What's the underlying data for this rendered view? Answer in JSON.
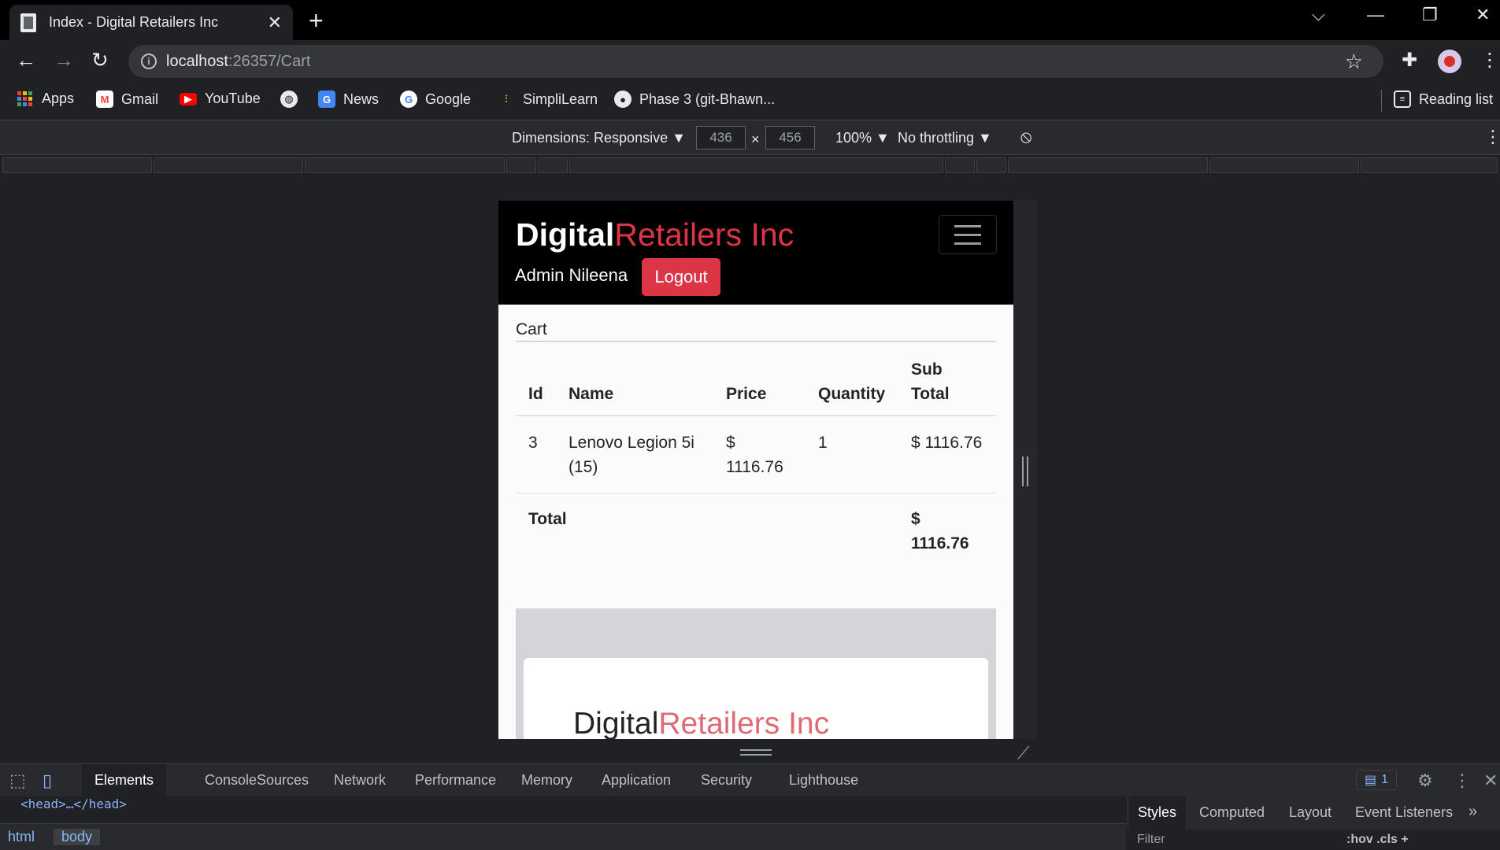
{
  "browser": {
    "tab_title": "Index - Digital Retailers Inc",
    "url_host": "localhost",
    "url_path": ":26357/Cart",
    "bookmarks": [
      "Apps",
      "Gmail",
      "YouTube",
      "News",
      "Google",
      "SimpliLearn",
      "Phase 3 (git-Bhawn..."
    ],
    "reading_list": "Reading list"
  },
  "device_toolbar": {
    "dimensions": "Dimensions: Responsive ▼",
    "width": "436",
    "x": "×",
    "height": "456",
    "zoom": "100% ▼",
    "throttling": "No throttling ▼"
  },
  "site": {
    "brand_a": "Digital",
    "brand_b": "Retailers Inc",
    "admin_name": "Admin Nileena",
    "logout_label": "Logout",
    "cart_heading": "Cart",
    "columns": [
      "Id",
      "Name",
      "Price",
      "Quantity",
      "Sub",
      "Total"
    ],
    "rows": [
      {
        "id": "3",
        "name": "Lenovo Legion 5i (15)",
        "price": "$ 1116.76",
        "quantity": "1",
        "subtotal": "$ 1116.76"
      }
    ],
    "total_label": "Total",
    "total_value": "$ 1116.76",
    "footer_brand_a": "Digital",
    "footer_brand_b": "Retailers Inc"
  },
  "devtools": {
    "tabs": [
      "Elements",
      "Console",
      "Sources",
      "Network",
      "Performance",
      "Memory",
      "Application",
      "Security",
      "Lighthouse"
    ],
    "issues_count": "1",
    "dom_line": "<head>…</head>",
    "breadcrumbs": [
      "html",
      "body"
    ],
    "styles_tabs": [
      "Styles",
      "Computed",
      "Layout",
      "Event Listeners"
    ],
    "filter_placeholder": "Filter",
    "filter_right": ":hov  .cls  +"
  }
}
